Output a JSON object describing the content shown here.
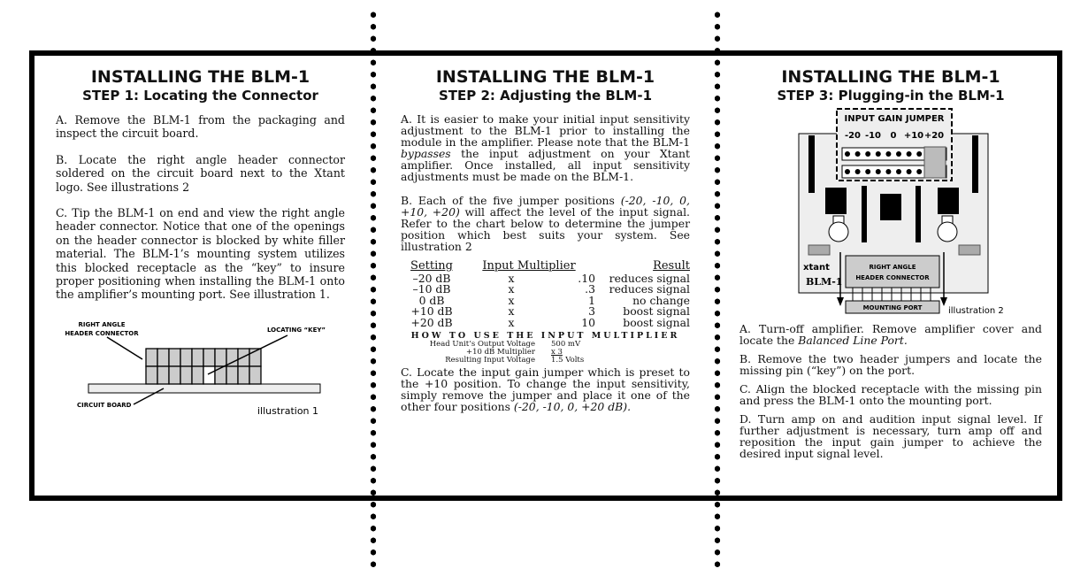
{
  "panels": [
    {
      "title": "INSTALLING THE BLM-1",
      "subtitle": "STEP 1: Locating the Connector",
      "paragraphs": [
        "A. Remove the BLM-1 from the packaging and inspect the circuit board.",
        "B. Locate the right angle header connector soldered on the circuit board next to the Xtant logo. See illustrations 2",
        "C. Tip the BLM-1 on end and view the right angle header connector. Notice that one of the openings on the header connector is blocked by white filler material. The BLM-1’s mounting system utilizes this blocked receptacle as the “key” to insure proper positioning when installing the BLM-1 onto the amplifier’s mounting port. See illustration 1."
      ],
      "illustration": {
        "label_connector_1": "RIGHT ANGLE",
        "label_connector_2": "HEADER CONNECTOR",
        "label_key": "LOCATING “KEY”",
        "label_board": "CIRCUIT BOARD",
        "caption": "illustration 1"
      }
    },
    {
      "title": "INSTALLING THE BLM-1",
      "subtitle": "STEP 2: Adjusting the BLM-1",
      "para_a_1": "A. It is easier to make your initial input sensitivity adjustment to the BLM-1 prior to installing the module in the amplifier. Please note that the BLM-1 ",
      "para_a_em": "bypasses",
      "para_a_2": " the input adjustment on your Xtant amplifier. Once installed, all input sensitivity adjustments must be made on the BLM-1.",
      "para_b_1": "B. Each of the five jumper positions ",
      "para_b_em": "(-20, -10, 0, +10, +20)",
      "para_b_2": " will affect the level of the input signal. Refer to the chart below to determine the jumper position which best suits your system. See illustration 2",
      "table": {
        "headers": [
          "Setting",
          "Input Multiplier",
          "Result"
        ],
        "rows": [
          [
            "–20 dB",
            "x",
            ".10",
            "reduces signal"
          ],
          [
            "–10 dB",
            "x",
            ".3",
            "reduces signal"
          ],
          [
            "0 dB",
            "x",
            "1",
            "no change"
          ],
          [
            "+10 dB",
            "x",
            "3",
            "boost signal"
          ],
          [
            "+20 dB",
            "x",
            "10",
            "boost signal"
          ]
        ]
      },
      "howto": {
        "title": "HOW TO USE THE INPUT MULTIPLIER",
        "rows": [
          [
            "Head Unit’s Output Voltage",
            "500 mV"
          ],
          [
            "+10 dB Multiplier",
            "x 3"
          ],
          [
            "Resulting Input Voltage",
            "1.5 Volts"
          ]
        ]
      },
      "para_c_1": "C. Locate the input gain jumper which is preset to the +10 position. To change the input sensitivity, simply remove the jumper and place it one of the other four positions ",
      "para_c_em": "(-20, -10, 0, +20 dB)."
    },
    {
      "title": "INSTALLING THE BLM-1",
      "subtitle": "STEP 3: Plugging-in the BLM-1",
      "illustration": {
        "jumper_label": "INPUT GAIN JUMPER",
        "positions": [
          "-20",
          "-10",
          "0",
          "+10",
          "+20"
        ],
        "connector_1": "RIGHT ANGLE",
        "connector_2": "HEADER CONNECTOR",
        "port": "MOUNTING PORT",
        "logo": "xtant",
        "model": "BLM-1",
        "caption": "illustration 2"
      },
      "para_a_1": "A. Turn-off amplifier. Remove amplifier cover and locate the ",
      "para_a_em": "Balanced Line Port.",
      "paragraphs": [
        "B. Remove the two header jumpers and locate the missing pin (“key”) on the port.",
        "C. Align the blocked receptacle with the missing pin and press the BLM-1 onto the mounting port.",
        "D. Turn amp on and audition input signal level. If further adjustment is necessary, turn amp off and reposition the input gain jumper to achieve the desired input signal level."
      ]
    }
  ]
}
